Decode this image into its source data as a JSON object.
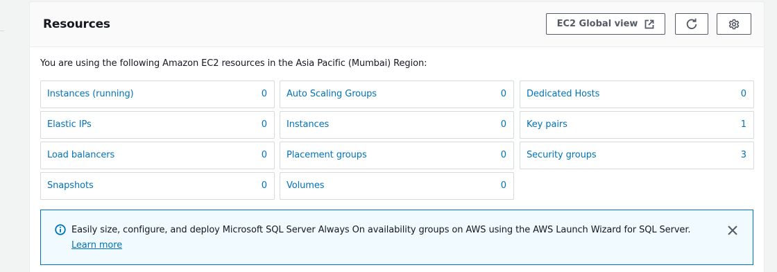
{
  "panel": {
    "title": "Resources",
    "buttons": {
      "global_view_label": "EC2 Global view",
      "global_view_icon": "external-link-icon",
      "refresh_icon": "refresh-icon",
      "settings_icon": "gear-icon"
    },
    "intro": "You are using the following Amazon EC2 resources in the Asia Pacific (Mumbai) Region:"
  },
  "resources": {
    "col1": [
      {
        "name": "Instances (running)",
        "count": "0"
      },
      {
        "name": "Elastic IPs",
        "count": "0"
      },
      {
        "name": "Load balancers",
        "count": "0"
      },
      {
        "name": "Snapshots",
        "count": "0"
      }
    ],
    "col2": [
      {
        "name": "Auto Scaling Groups",
        "count": "0"
      },
      {
        "name": "Instances",
        "count": "0"
      },
      {
        "name": "Placement groups",
        "count": "0"
      },
      {
        "name": "Volumes",
        "count": "0"
      }
    ],
    "col3": [
      {
        "name": "Dedicated Hosts",
        "count": "0"
      },
      {
        "name": "Key pairs",
        "count": "1"
      },
      {
        "name": "Security groups",
        "count": "3"
      }
    ]
  },
  "flash": {
    "icon": "info-icon",
    "message": "Easily size, configure, and deploy Microsoft SQL Server Always On availability groups on AWS using the AWS Launch Wizard for SQL Server. ",
    "link_text": "Learn more",
    "close_icon": "close-icon"
  },
  "colors": {
    "link": "#0073bb",
    "text": "#16191f",
    "border": "#d5dbdb",
    "flash_bg": "#f1faff"
  }
}
